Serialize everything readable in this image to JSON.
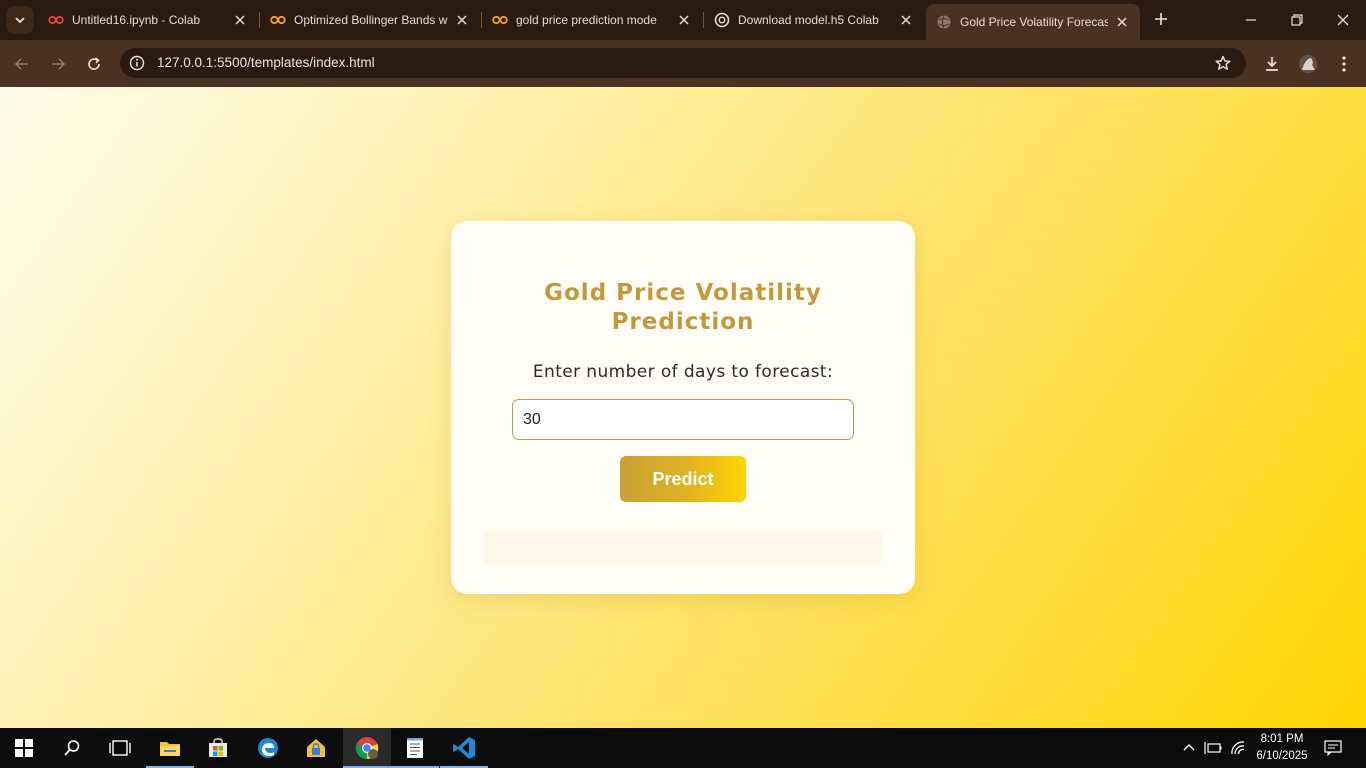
{
  "browser": {
    "tabs": [
      {
        "title": "Untitled16.ipynb - Colab",
        "icon": "colab-icon"
      },
      {
        "title": "Optimized Bollinger Bands w",
        "icon": "colab-icon"
      },
      {
        "title": "gold price prediction mode",
        "icon": "colab-icon"
      },
      {
        "title": "Download model.h5 Colab",
        "icon": "openai-icon"
      },
      {
        "title": "Gold Price Volatility Forecast",
        "icon": "globe-icon",
        "active": true
      }
    ],
    "url": "127.0.0.1:5500/templates/index.html"
  },
  "page": {
    "title_line1": "Gold Price Volatility",
    "title_line2": "Prediction",
    "label": "Enter number of days to forecast:",
    "input_value": "30",
    "predict_label": "Predict"
  },
  "taskbar": {
    "time": "8:01 PM",
    "date": "6/10/2025"
  },
  "colors": {
    "accent_gold": "#c09a3c",
    "button_gradient_start": "#c9a035",
    "button_gradient_end": "#ffd500",
    "browser_frame": "#4a3222"
  }
}
